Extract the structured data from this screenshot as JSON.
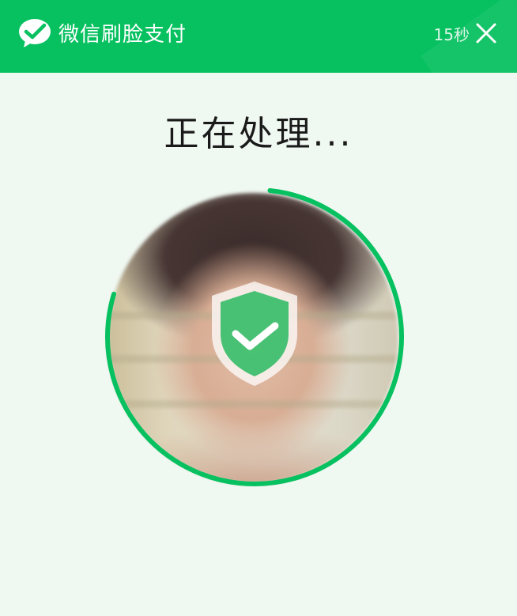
{
  "header": {
    "title": "微信刷脸支付",
    "countdown": "15秒",
    "brand_color": "#07c160"
  },
  "main": {
    "status_text": "正在处理...",
    "progress_fraction": 0.78,
    "ring_color": "#07c160",
    "overlay_icon": "shield-check-icon"
  }
}
